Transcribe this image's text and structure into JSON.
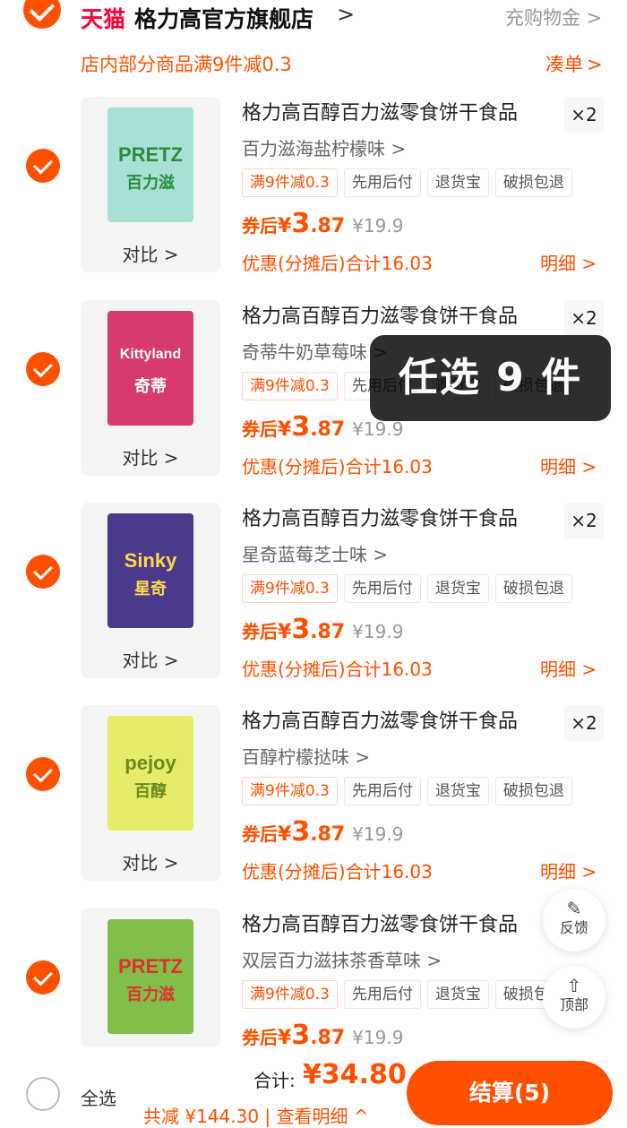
{
  "store": {
    "brand_logo": "天猫",
    "name": "格力高官方旗舰店",
    "chevron": ">",
    "coupon_link": "充购物金 >",
    "promo_text": "店内部分商品满9件减0.3",
    "promo_link": "凑单",
    "promo_chevron": ">"
  },
  "items": [
    {
      "title": "格力高百醇百力滋零食饼干食品",
      "qty": "×2",
      "sku": "百力滋海盐柠檬味 >",
      "tags": [
        "满9件减0.3",
        "先用后付",
        "退货宝",
        "破损包退"
      ],
      "price_label": "券后",
      "price_yen": "¥",
      "price_int": "3",
      "price_dec": ".87",
      "orig_price": "¥19.9",
      "discount": "优惠(分摊后)合计16.03",
      "detail": "明细 >",
      "compare": "对比 >",
      "pack_brand": "PRETZ",
      "pack_name": "百力滋",
      "pack_color": "#a8e0d6",
      "pack_accent": "#2a8c3c"
    },
    {
      "title": "格力高百醇百力滋零食饼干食品",
      "qty": "×2",
      "sku": "奇蒂牛奶草莓味 >",
      "tags": [
        "满9件减0.3",
        "先用后付",
        "退货宝",
        "破损包退"
      ],
      "price_label": "券后",
      "price_yen": "¥",
      "price_int": "3",
      "price_dec": ".87",
      "orig_price": "¥19.9",
      "discount": "优惠(分摊后)合计16.03",
      "detail": "明细 >",
      "compare": "对比 >",
      "pack_brand": "Kittyland",
      "pack_name": "奇蒂",
      "pack_color": "#d63a6e",
      "pack_accent": "#ffffff"
    },
    {
      "title": "格力高百醇百力滋零食饼干食品",
      "qty": "×2",
      "sku": "星奇蓝莓芝士味 >",
      "tags": [
        "满9件减0.3",
        "先用后付",
        "退货宝",
        "破损包退"
      ],
      "price_label": "券后",
      "price_yen": "¥",
      "price_int": "3",
      "price_dec": ".87",
      "orig_price": "¥19.9",
      "discount": "优惠(分摊后)合计16.03",
      "detail": "明细 >",
      "compare": "对比 >",
      "pack_brand": "Sinky",
      "pack_name": "星奇",
      "pack_color": "#4b3a8c",
      "pack_accent": "#ffd84a"
    },
    {
      "title": "格力高百醇百力滋零食饼干食品",
      "qty": "×2",
      "sku": "百醇柠檬挞味 >",
      "tags": [
        "满9件减0.3",
        "先用后付",
        "退货宝",
        "破损包退"
      ],
      "price_label": "券后",
      "price_yen": "¥",
      "price_int": "3",
      "price_dec": ".87",
      "orig_price": "¥19.9",
      "discount": "优惠(分摊后)合计16.03",
      "detail": "明细 >",
      "compare": "对比 >",
      "pack_brand": "pejoy",
      "pack_name": "百醇",
      "pack_color": "#e6ec6a",
      "pack_accent": "#6a8a1e"
    },
    {
      "title": "格力高百醇百力滋零食饼干食品",
      "qty": "",
      "sku": "双层百力滋抹茶香草味 >",
      "tags": [
        "满9件减0.3",
        "先用后付",
        "退货宝",
        "破损包退"
      ],
      "price_label": "券后",
      "price_yen": "¥",
      "price_int": "3",
      "price_dec": ".87",
      "orig_price": "¥19.9",
      "discount": "",
      "detail": "",
      "compare": "",
      "pack_brand": "PRETZ",
      "pack_name": "百力滋",
      "pack_color": "#7fbf4a",
      "pack_accent": "#e0312d"
    }
  ],
  "overlay": {
    "text": "任选 9 件"
  },
  "float_buttons": {
    "feedback_icon": "✎",
    "feedback_label": "反馈",
    "top_icon": "⇧",
    "top_label": "顶部"
  },
  "footer": {
    "select_all": "全选",
    "total_label": "合计:",
    "total_value": "¥34.80",
    "saved": "共减 ¥144.30 | 查看明细 ^",
    "checkout": "结算(5)"
  },
  "colors": {
    "accent": "#ff5000",
    "tmall_red": "#ff0036",
    "muted": "#999999"
  }
}
